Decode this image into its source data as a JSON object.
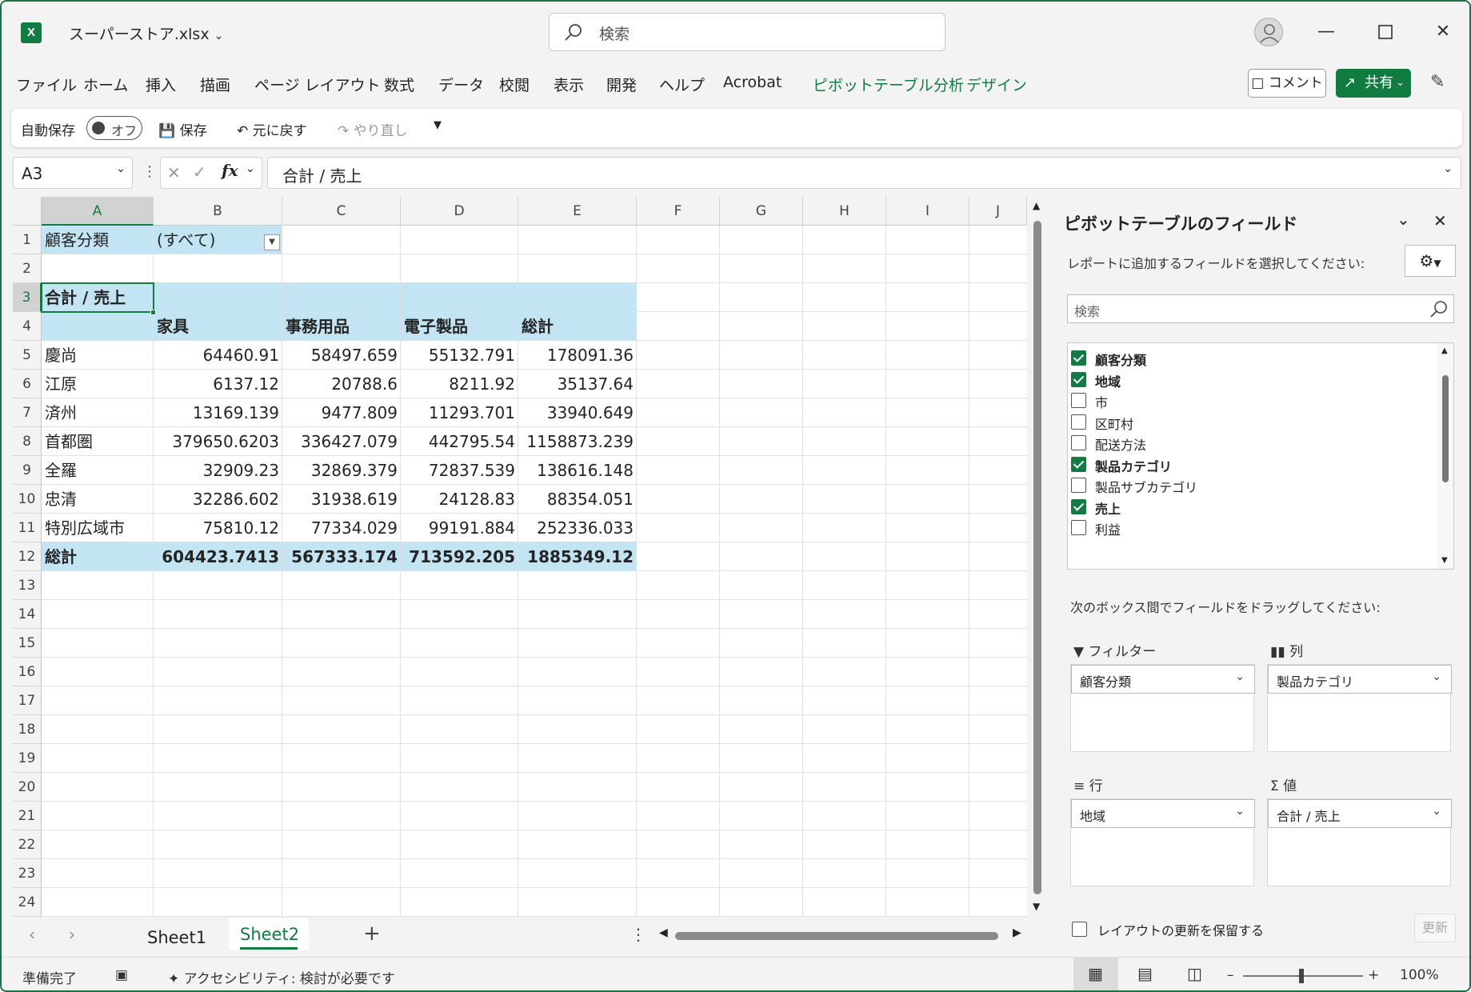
{
  "window": {
    "file_name": "スーパーストア.xlsx",
    "app_logo": "X",
    "search_placeholder": "検索"
  },
  "menu": {
    "items": [
      "ファイル",
      "ホーム",
      "挿入",
      "描画",
      "ページ レイアウト",
      "数式",
      "データ",
      "校閲",
      "表示",
      "開発",
      "ヘルプ",
      "Acrobat"
    ],
    "context_items": [
      "ピボットテーブル分析",
      "デザイン"
    ],
    "comment_label": "コメント",
    "share_label": "共有"
  },
  "quick_access": {
    "autosave_label": "自動保存",
    "autosave_state": "オフ",
    "save_label": "保存",
    "undo_label": "元に戻す",
    "redo_label": "やり直し"
  },
  "formula_bar": {
    "name_box": "A3",
    "fx_label": "fx",
    "formula": "合計 / 売上"
  },
  "columns": [
    "A",
    "B",
    "C",
    "D",
    "E",
    "F",
    "G",
    "H",
    "I",
    "J"
  ],
  "rows": [
    "1",
    "2",
    "3",
    "4",
    "5",
    "6",
    "7",
    "8",
    "9",
    "10",
    "11",
    "12",
    "13",
    "14",
    "15",
    "16",
    "17",
    "18",
    "19",
    "20",
    "21",
    "22",
    "23",
    "24"
  ],
  "pivot": {
    "filter_label": "顧客分類",
    "filter_value": "(すべて)",
    "value_header": "合計 / 売上",
    "col_headers": [
      "家具",
      "事務用品",
      "電子製品",
      "総計"
    ],
    "data_rows": [
      {
        "label": "慶尚",
        "values": [
          "64460.91",
          "58497.659",
          "55132.791",
          "178091.36"
        ]
      },
      {
        "label": "江原",
        "values": [
          "6137.12",
          "20788.6",
          "8211.92",
          "35137.64"
        ]
      },
      {
        "label": "済州",
        "values": [
          "13169.139",
          "9477.809",
          "11293.701",
          "33940.649"
        ]
      },
      {
        "label": "首都圏",
        "values": [
          "379650.6203",
          "336427.079",
          "442795.54",
          "1158873.239"
        ]
      },
      {
        "label": "全羅",
        "values": [
          "32909.23",
          "32869.379",
          "72837.539",
          "138616.148"
        ]
      },
      {
        "label": "忠清",
        "values": [
          "32286.602",
          "31938.619",
          "24128.83",
          "88354.051"
        ]
      },
      {
        "label": "特別広域市",
        "values": [
          "75810.12",
          "77334.029",
          "99191.884",
          "252336.033"
        ]
      }
    ],
    "total_row": {
      "label": "総計",
      "values": [
        "604423.7413",
        "567333.174",
        "713592.205",
        "1885349.12"
      ]
    }
  },
  "sheets": {
    "tabs": [
      "Sheet1",
      "Sheet2"
    ],
    "active": "Sheet2"
  },
  "pane": {
    "title": "ピボットテーブルのフィールド",
    "subtitle": "レポートに追加するフィールドを選択してください:",
    "search_placeholder": "検索",
    "fields": [
      {
        "name": "顧客分類",
        "checked": true
      },
      {
        "name": "地域",
        "checked": true
      },
      {
        "name": "市",
        "checked": false
      },
      {
        "name": "区町村",
        "checked": false
      },
      {
        "name": "配送方法",
        "checked": false
      },
      {
        "name": "製品カテゴリ",
        "checked": true
      },
      {
        "name": "製品サブカテゴリ",
        "checked": false
      },
      {
        "name": "売上",
        "checked": true
      },
      {
        "name": "利益",
        "checked": false
      }
    ],
    "drag_label": "次のボックス間でフィールドをドラッグしてください:",
    "areas": {
      "filter": {
        "label": "フィルター",
        "value": "顧客分類"
      },
      "columns": {
        "label": "列",
        "value": "製品カテゴリ"
      },
      "rows": {
        "label": "行",
        "value": "地域"
      },
      "values": {
        "label": "値",
        "value": "合計 / 売上"
      }
    },
    "defer_label": "レイアウトの更新を保留する",
    "update_label": "更新"
  },
  "status": {
    "ready": "準備完了",
    "accessibility": "アクセシビリティ: 検討が必要です",
    "zoom": "100%"
  }
}
